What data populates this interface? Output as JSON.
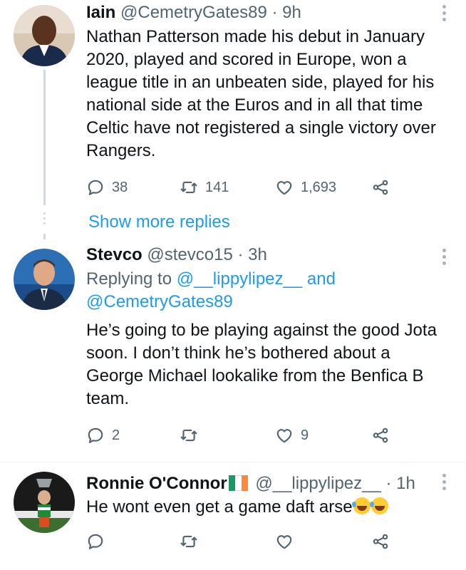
{
  "tweets": [
    {
      "name": "Iain",
      "handle": "@CemetryGates89",
      "time": "· 9h",
      "text": "Nathan Patterson made his debut in January 2020, played and scored in Europe, won a league title in an unbeaten side, played for his national side at the Euros and in all that time Celtic have not registered a single victory over Rangers.",
      "replies": "38",
      "retweets": "141",
      "likes": "1,693"
    },
    {
      "name": "Stevco",
      "handle": "@stevco15",
      "time": "· 3h",
      "replying_prefix": "Replying to ",
      "replying_user1": "@__lippylipez__",
      "replying_and": " and",
      "replying_user2": "@CemetryGates89",
      "text": "He’s going to be playing against the good Jota soon. I don’t think he’s bothered about a George Michael lookalike from the Benfica B team.",
      "replies": "2",
      "retweets": "",
      "likes": "9"
    },
    {
      "name": "Ronnie O'Connor",
      "handle": "@__lippylipez__",
      "time": "· 1h",
      "text": "He wont even get a game daft arse",
      "replies": "",
      "retweets": "",
      "likes": ""
    }
  ],
  "show_more_replies": "Show more replies",
  "colors": {
    "accent": "#1d9bf0",
    "muted": "#536471",
    "thread_line": "#cfd9de",
    "flag_green": "#169b62",
    "flag_white": "#ffffff",
    "flag_orange": "#ff883e"
  },
  "icons": [
    "reply-icon",
    "retweet-icon",
    "like-icon",
    "share-icon",
    "more-icon",
    "irish-flag-emoji",
    "rofl-emoji"
  ]
}
